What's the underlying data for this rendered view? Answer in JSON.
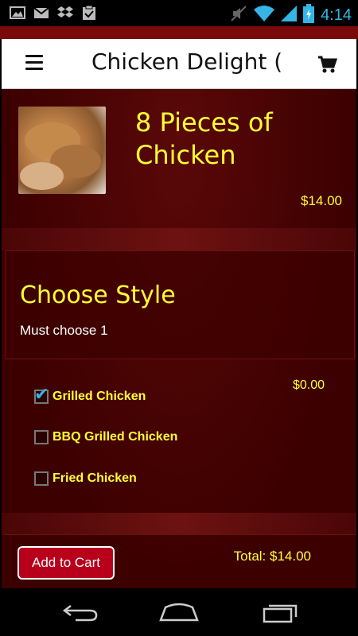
{
  "status_bar": {
    "time": "4:14",
    "left_icons": [
      "image-icon",
      "gmail-icon",
      "dropbox-icon",
      "clipboard-check-icon"
    ],
    "right_icons": [
      "mute-icon",
      "wifi-icon",
      "signal-icon",
      "battery-icon"
    ],
    "accent": "#35b5e5"
  },
  "app_bar": {
    "title": "Chicken Delight (N",
    "menu_icon": "hamburger-menu-icon",
    "cart_icon": "cart-icon"
  },
  "product": {
    "title": "8 Pieces of Chicken",
    "price": "$14.00"
  },
  "style_section": {
    "heading": "Choose Style",
    "requirement": "Must choose 1",
    "option_price": "$0.00",
    "options": [
      {
        "label": "Grilled Chicken",
        "checked": true
      },
      {
        "label": "BBQ Grilled Chicken",
        "checked": false
      },
      {
        "label": "Fried Chicken",
        "checked": false
      }
    ]
  },
  "footer": {
    "add_to_cart": "Add to Cart",
    "total": "Total: $14.00"
  },
  "colors": {
    "accent_yellow": "#ffff33",
    "button_red": "#b8001c",
    "background_maroon": "#3c0000"
  }
}
